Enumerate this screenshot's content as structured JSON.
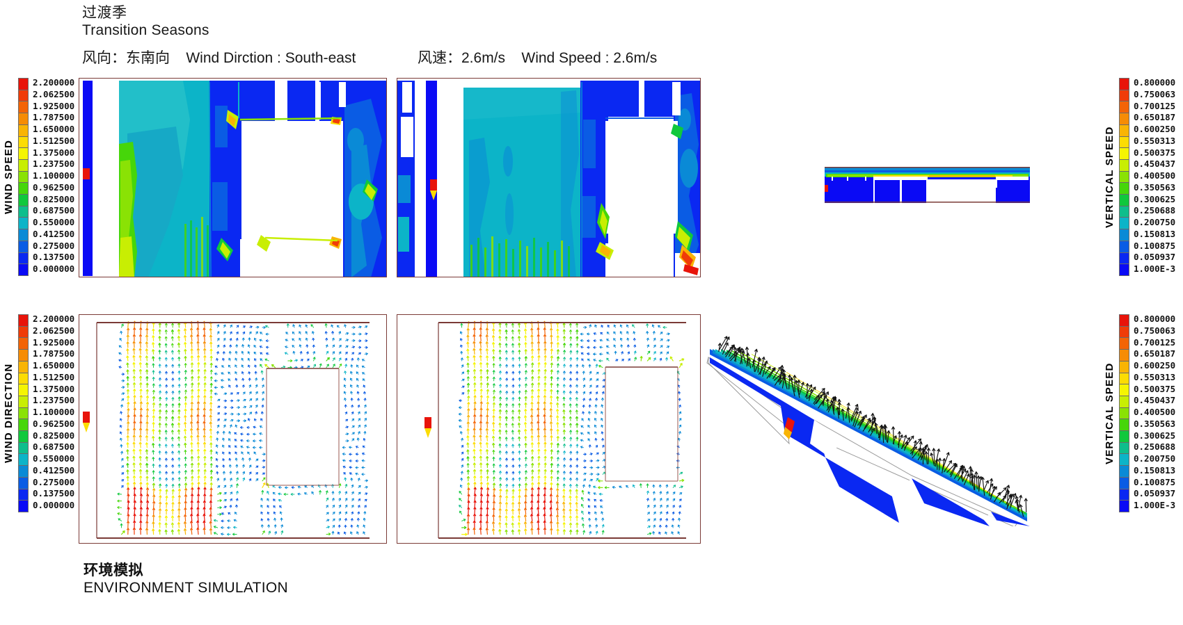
{
  "header": {
    "season_cn": "过渡季",
    "season_en": "Transition Seasons",
    "wind_direction_cn": "风向：东南向",
    "wind_direction_en": "Wind Dirction : South-east",
    "wind_speed_cn": "风速：2.6m/s",
    "wind_speed_en": "Wind Speed : 2.6m/s"
  },
  "footer": {
    "caption_cn": "环境模拟",
    "caption_en": "ENVIRONMENT SIMULATION"
  },
  "legends": {
    "wind_speed_top": {
      "title": "WIND SPEED",
      "labels": [
        "2.200000",
        "2.062500",
        "1.925000",
        "1.787500",
        "1.650000",
        "1.512500",
        "1.375000",
        "1.237500",
        "1.100000",
        "0.962500",
        "0.825000",
        "0.687500",
        "0.550000",
        "0.412500",
        "0.275000",
        "0.137500",
        "0.000000"
      ]
    },
    "wind_direction_bottom": {
      "title": "WIND DIRECTION",
      "labels": [
        "2.200000",
        "2.062500",
        "1.925000",
        "1.787500",
        "1.650000",
        "1.512500",
        "1.375000",
        "1.237500",
        "1.100000",
        "0.962500",
        "0.825000",
        "0.687500",
        "0.550000",
        "0.412500",
        "0.275000",
        "0.137500",
        "0.000000"
      ]
    },
    "vertical_speed_top": {
      "title": "VERTICAL SPEED",
      "labels": [
        "0.800000",
        "0.750063",
        "0.700125",
        "0.650187",
        "0.600250",
        "0.550313",
        "0.500375",
        "0.450437",
        "0.400500",
        "0.350563",
        "0.300625",
        "0.250688",
        "0.200750",
        "0.150813",
        "0.100875",
        "0.050937",
        "1.000E-3"
      ]
    },
    "vertical_speed_bottom": {
      "title": "VERTICAL SPEED",
      "labels": [
        "0.800000",
        "0.750063",
        "0.700125",
        "0.650187",
        "0.600250",
        "0.550313",
        "0.500375",
        "0.450437",
        "0.400500",
        "0.350563",
        "0.300625",
        "0.250688",
        "0.200750",
        "0.150813",
        "0.100875",
        "0.050937",
        "1.000E-3"
      ]
    }
  },
  "colorbar_swatches": [
    "#e8140a",
    "#f03c08",
    "#f36406",
    "#f68c05",
    "#f9b404",
    "#fcdc03",
    "#f5f502",
    "#c8ee03",
    "#8ae205",
    "#46d60a",
    "#10c83c",
    "#0ebe8c",
    "#0cb4c8",
    "#0a8ad6",
    "#0a5ce4",
    "#0a28f2",
    "#0a0af5"
  ],
  "chart_data": {
    "type": "heatmap",
    "title": "Transition Seasons — CFD Environment Simulation",
    "panels": [
      {
        "id": "panel-wind-speed-plan-1",
        "row": 1,
        "col": 1,
        "plot_type": "contour",
        "variable": "Wind Speed",
        "units": "m/s",
        "view": "plan",
        "colorbar": "wind_speed_top",
        "vmin": 0.0,
        "vmax": 2.2,
        "n_bands": 16,
        "band_step": 0.1375,
        "description": "Plan-view wind speed contour over courtyard block layout; cyan open-court core 0.55-0.825 m/s, deep blue sheltered zones below 0.275 m/s, green-yellow corner acceleration up to 1.65 m/s, isolated red hot spots near 2.2 m/s at building corners.",
        "inlet_marker": {
          "color": "#e8140a",
          "position": "west-edge",
          "label": "inlet"
        }
      },
      {
        "id": "panel-wind-speed-plan-2",
        "row": 1,
        "col": 2,
        "plot_type": "contour",
        "variable": "Wind Speed",
        "units": "m/s",
        "view": "plan",
        "colorbar": "wind_speed_top",
        "vmin": 0.0,
        "vmax": 2.2,
        "n_bands": 16,
        "band_step": 0.1375,
        "description": "Second plan-view wind speed contour at alternate height; large uniform cyan field 0.687-0.825 m/s across the open court, blue wake behind the central mass, green-to-red jet at the south-east outlet corner.",
        "inlet_marker": {
          "color": "#e8140a",
          "position": "west-edge",
          "label": "inlet"
        }
      },
      {
        "id": "panel-vertical-speed-section",
        "row": 1,
        "col": 3,
        "plot_type": "contour",
        "variable": "Vertical Speed",
        "units": "m/s",
        "view": "section",
        "colorbar": "vertical_speed_top",
        "vmin": 0.001,
        "vmax": 0.8,
        "n_bands": 16,
        "band_step": 0.049937,
        "description": "Long horizontal section band: dominant deep blue body near 0.001-0.10 m/s with a continuous green-yellow roof-level shear layer 0.35-0.60 m/s running the full length above the building roofline."
      },
      {
        "id": "panel-wind-direction-vectors-1",
        "row": 2,
        "col": 1,
        "plot_type": "vector",
        "variable": "Wind Direction",
        "units": "m/s",
        "view": "plan",
        "colorbar": "wind_direction_bottom",
        "vmin": 0.0,
        "vmax": 2.2,
        "n_bands": 16,
        "band_step": 0.1375,
        "description": "Plan-view velocity vector field; arrows coloured by magnitude. Strong south-to-north cyan-green columns 0.55-1.10 m/s through the open court, recirculating blue eddies 0.0-0.275 m/s in building wakes, yellow-orange arrows above 1.5 m/s at gap throats."
      },
      {
        "id": "panel-wind-direction-vectors-2",
        "row": 2,
        "col": 2,
        "plot_type": "vector",
        "variable": "Wind Direction",
        "units": "m/s",
        "view": "plan",
        "colorbar": "wind_direction_bottom",
        "vmin": 0.0,
        "vmax": 2.2,
        "n_bands": 16,
        "band_step": 0.1375,
        "description": "Second plan-view vector field; near-parallel cyan streamwise arrows 0.41-0.82 m/s over the court, pale blue stagnation cells behind blocks, green-yellow acceleration near the south-east corner."
      },
      {
        "id": "panel-vertical-speed-3d",
        "row": 2,
        "col": 3,
        "plot_type": "vector",
        "variable": "Vertical Speed",
        "units": "m/s",
        "view": "3d-perspective",
        "colorbar": "vertical_speed_bottom",
        "vmin": 0.001,
        "vmax": 0.8,
        "n_bands": 16,
        "band_step": 0.049937,
        "description": "Tilted 3D perspective of the section plane with black velocity vectors projecting off the roof surface; blue plane body 0.001-0.15 m/s with a bright green-yellow roof-edge ridge reaching 0.45-0.65 m/s."
      }
    ],
    "legend_position": "outside-left and outside-right",
    "grid": false
  }
}
